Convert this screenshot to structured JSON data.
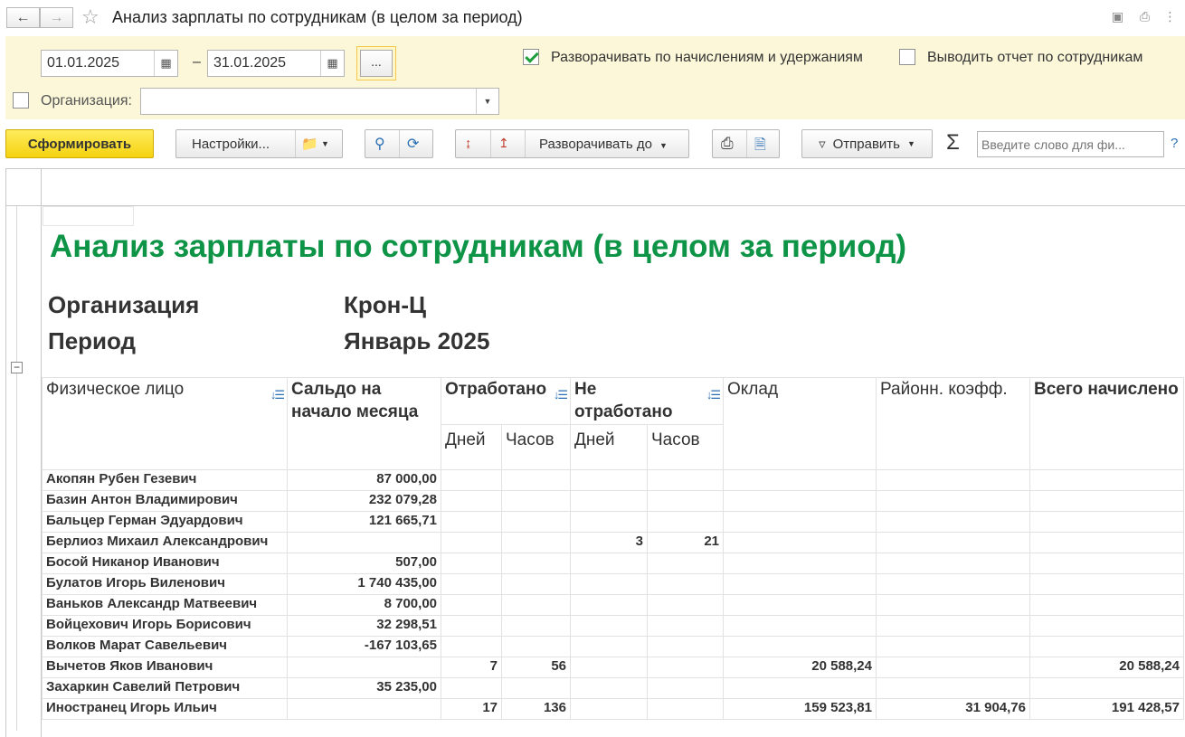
{
  "window": {
    "title": "Анализ зарплаты по сотрудникам (в целом за период)",
    "nav_back_icon": "arrow-left-icon",
    "nav_forward_icon": "arrow-right-icon"
  },
  "params": {
    "date_from": "01.01.2025",
    "date_to": "31.01.2025",
    "dash": "–",
    "ellipsis_label": "...",
    "expand_by_accruals_label": "Разворачивать по начислениям и удержаниям",
    "expand_by_accruals_checked": true,
    "by_employees_label": "Выводить отчет по сотрудникам",
    "by_employees_checked": false,
    "organization_label": "Организация:",
    "organization_checked": false,
    "organization_value": ""
  },
  "toolbar": {
    "generate_label": "Сформировать",
    "settings_label": "Настройки...",
    "expand_to_label": "Разворачивать до",
    "send_label": "Отправить",
    "search_placeholder": "Введите слово для фи...",
    "help_label": "?",
    "sigma_label": "Σ"
  },
  "report": {
    "title": "Анализ зарплаты по сотрудникам (в целом за период)",
    "org_label": "Организация",
    "org_value": "Крон-Ц",
    "period_label": "Период",
    "period_value": "Январь 2025",
    "columns": {
      "person": "Физическое лицо",
      "balance": "Сальдо на начало месяца",
      "worked": "Отработано",
      "not_worked": "Не отработано",
      "salary": "Оклад",
      "regional": "Районн. коэфф.",
      "total": "Всего начислено",
      "days": "Дней",
      "hours": "Часов"
    },
    "rows": [
      {
        "name": "Акопян Рубен Гезевич",
        "balance": "87 000,00",
        "wd": "",
        "wh": "",
        "nd": "",
        "nh": "",
        "salary": "",
        "regional": "",
        "total": ""
      },
      {
        "name": "Базин Антон Владимирович",
        "balance": "232 079,28",
        "wd": "",
        "wh": "",
        "nd": "",
        "nh": "",
        "salary": "",
        "regional": "",
        "total": ""
      },
      {
        "name": "Бальцер Герман Эдуардович",
        "balance": "121 665,71",
        "wd": "",
        "wh": "",
        "nd": "",
        "nh": "",
        "salary": "",
        "regional": "",
        "total": ""
      },
      {
        "name": "Берлиоз Михаил Александрович",
        "balance": "",
        "wd": "",
        "wh": "",
        "nd": "3",
        "nh": "21",
        "salary": "",
        "regional": "",
        "total": ""
      },
      {
        "name": "Босой Никанор Иванович",
        "balance": "507,00",
        "wd": "",
        "wh": "",
        "nd": "",
        "nh": "",
        "salary": "",
        "regional": "",
        "total": ""
      },
      {
        "name": "Булатов Игорь Виленович",
        "balance": "1 740 435,00",
        "wd": "",
        "wh": "",
        "nd": "",
        "nh": "",
        "salary": "",
        "regional": "",
        "total": ""
      },
      {
        "name": "Ваньков Александр Матвеевич",
        "balance": "8 700,00",
        "wd": "",
        "wh": "",
        "nd": "",
        "nh": "",
        "salary": "",
        "regional": "",
        "total": ""
      },
      {
        "name": "Войцехович Игорь Борисович",
        "balance": "32 298,51",
        "wd": "",
        "wh": "",
        "nd": "",
        "nh": "",
        "salary": "",
        "regional": "",
        "total": ""
      },
      {
        "name": "Волков Марат Савельевич",
        "balance": "-167 103,65",
        "wd": "",
        "wh": "",
        "nd": "",
        "nh": "",
        "salary": "",
        "regional": "",
        "total": ""
      },
      {
        "name": "Вычетов Яков Иванович",
        "balance": "",
        "wd": "7",
        "wh": "56",
        "nd": "",
        "nh": "",
        "salary": "20 588,24",
        "regional": "",
        "total": "20 588,24"
      },
      {
        "name": "Захаркин Савелий Петрович",
        "balance": "35 235,00",
        "wd": "",
        "wh": "",
        "nd": "",
        "nh": "",
        "salary": "",
        "regional": "",
        "total": ""
      },
      {
        "name": "Иностранец Игорь Ильич",
        "balance": "",
        "wd": "17",
        "wh": "136",
        "nd": "",
        "nh": "",
        "salary": "159 523,81",
        "regional": "31 904,76",
        "total": "191 428,57"
      }
    ]
  }
}
